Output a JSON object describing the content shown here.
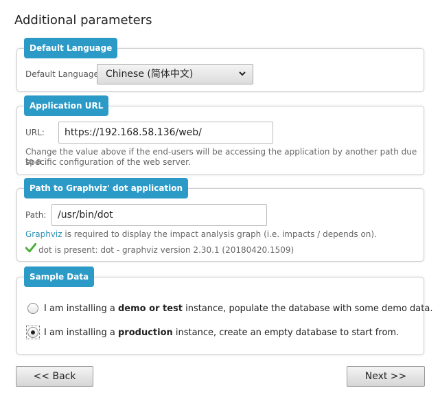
{
  "page": {
    "title": "Additional parameters"
  },
  "language": {
    "legend": "Default Language",
    "label": "Default Language:",
    "selected": "Chinese (简体中文)"
  },
  "url": {
    "legend": "Application URL",
    "label": "URL:",
    "value": "https://192.168.58.136/web/",
    "help_line1": "Change the value above if the end-users will be accessing the application by another path due to a",
    "help_line2": "specific configuration of the web server."
  },
  "graphviz": {
    "legend": "Path to Graphviz' dot application",
    "label": "Path:",
    "value": "/usr/bin/dot",
    "help_link": "Graphviz",
    "help_rest": " is required to display the impact analysis graph (i.e. impacts / depends on).",
    "status": "dot is present: dot - graphviz version 2.30.1 (20180420.1509)"
  },
  "sample": {
    "legend": "Sample Data",
    "option_demo": {
      "prefix": "I am installing a ",
      "bold": "demo or test",
      "suffix": " instance, populate the database with some demo data."
    },
    "option_production": {
      "prefix": "I am installing a ",
      "bold": "production",
      "suffix": " instance, create an empty database to start from."
    },
    "selected": "production"
  },
  "buttons": {
    "back": "<< Back",
    "next": "Next >>"
  },
  "colors": {
    "legend_bg": "#2c9ac7",
    "link": "#2c8fb5",
    "check": "#4caf3a"
  }
}
